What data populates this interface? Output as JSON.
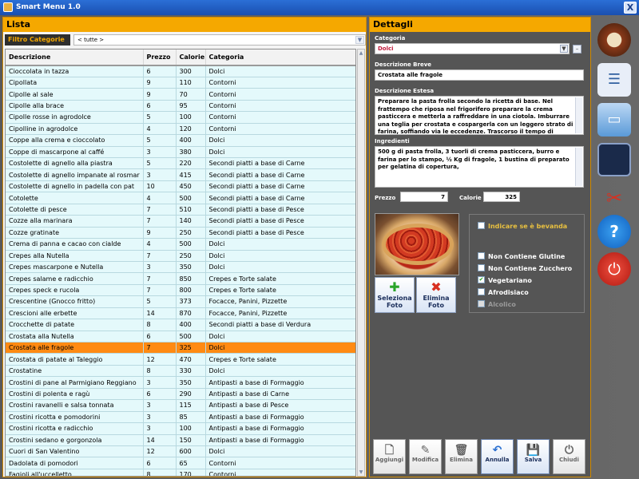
{
  "window": {
    "title": "Smart Menu 1.0",
    "close_glyph": "X"
  },
  "lista": {
    "title": "Lista",
    "filter_label": "Filtro Categorie",
    "filter_value": "< tutte >",
    "columns": [
      "Descrizione",
      "Prezzo",
      "Calorie",
      "Categoria"
    ],
    "rows": [
      [
        "Cioccolata in tazza",
        "6",
        "300",
        "Dolci"
      ],
      [
        "Cipollata",
        "9",
        "110",
        "Contorni"
      ],
      [
        "Cipolle al sale",
        "9",
        "70",
        "Contorni"
      ],
      [
        "Cipolle alla brace",
        "6",
        "95",
        "Contorni"
      ],
      [
        "Cipolle rosse in agrodolce",
        "5",
        "100",
        "Contorni"
      ],
      [
        "Cipolline in agrodolce",
        "4",
        "120",
        "Contorni"
      ],
      [
        "Coppe alla crema e cioccolato",
        "5",
        "400",
        "Dolci"
      ],
      [
        "Coppe di mascarpone al caffé",
        "3",
        "380",
        "Dolci"
      ],
      [
        "Costolette di agnello alla piastra",
        "5",
        "220",
        "Secondi piatti a base di Carne"
      ],
      [
        "Costolette di agnello impanate al rosmar",
        "3",
        "415",
        "Secondi piatti a base di Carne"
      ],
      [
        "Costolette di agnello in padella con pat",
        "10",
        "450",
        "Secondi piatti a base di Carne"
      ],
      [
        "Cotolette",
        "4",
        "500",
        "Secondi piatti a base di Carne"
      ],
      [
        "Cotolette di pesce",
        "7",
        "510",
        "Secondi piatti a base di Pesce"
      ],
      [
        "Cozze alla marinara",
        "7",
        "140",
        "Secondi piatti a base di Pesce"
      ],
      [
        "Cozze gratinate",
        "9",
        "250",
        "Secondi piatti a base di Pesce"
      ],
      [
        "Crema di panna e cacao con cialde",
        "4",
        "500",
        "Dolci"
      ],
      [
        "Crepes alla Nutella",
        "7",
        "250",
        "Dolci"
      ],
      [
        "Crepes mascarpone e Nutella",
        "3",
        "350",
        "Dolci"
      ],
      [
        "Crepes salame e radicchio",
        "7",
        "850",
        "Crepes e Torte salate"
      ],
      [
        "Crepes speck e rucola",
        "7",
        "800",
        "Crepes e Torte salate"
      ],
      [
        "Crescentine (Gnocco fritto)",
        "5",
        "373",
        "Focacce, Panini, Pizzette"
      ],
      [
        "Crescioni alle erbette",
        "14",
        "870",
        "Focacce, Panini, Pizzette"
      ],
      [
        "Crocchette di patate",
        "8",
        "400",
        "Secondi piatti a base di Verdura"
      ],
      [
        "Crostata alla Nutella",
        "6",
        "500",
        "Dolci"
      ],
      [
        "Crostata alle fragole",
        "7",
        "325",
        "Dolci"
      ],
      [
        "Crostata di patate al Taleggio",
        "12",
        "470",
        "Crepes e Torte salate"
      ],
      [
        "Crostatine",
        "8",
        "330",
        "Dolci"
      ],
      [
        "Crostini di pane al Parmigiano Reggiano",
        "3",
        "350",
        "Antipasti a base di Formaggio"
      ],
      [
        "Crostini di polenta e ragù",
        "6",
        "290",
        "Antipasti a base di Carne"
      ],
      [
        "Crostini ravanelli e salsa tonnata",
        "3",
        "115",
        "Antipasti a base di Pesce"
      ],
      [
        "Crostini ricotta e pomodorini",
        "3",
        "85",
        "Antipasti a base di Formaggio"
      ],
      [
        "Crostini ricotta e radicchio",
        "3",
        "100",
        "Antipasti a base di Formaggio"
      ],
      [
        "Crostini sedano e gorgonzola",
        "14",
        "150",
        "Antipasti a base di Formaggio"
      ],
      [
        "Cuori di San Valentino",
        "12",
        "600",
        "Dolci"
      ],
      [
        "Dadolata di pomodori",
        "6",
        "65",
        "Contorni"
      ],
      [
        "Fagioli all'uccelletto",
        "8",
        "170",
        "Contorni"
      ]
    ],
    "selected_index": 24
  },
  "dettagli": {
    "title": "Dettagli",
    "categoria_label": "Categoria",
    "categoria_value": "Dolci",
    "descrizione_breve_label": "Descrizione Breve",
    "descrizione_breve_value": "Crostata alle fragole",
    "descrizione_estesa_label": "Descrizione Estesa",
    "descrizione_estesa_value": "Preparare la pasta frolla secondo la ricetta di base. Nel frattempo che riposa nel frigorifero preparare la crema pasticcera e metterla a raffreddare in una ciotola.  Imburrare una teglia per crostata e cospargerla con un leggero strato di farina, soffiando via le eccedenze.  Trascorso il tempo di riposo della pasta, accendere il",
    "ingredienti_label": "Ingredienti",
    "ingredienti_value": "500 g di pasta frolla, 3 tuorli di crema pasticcera, burro e farina per lo stampo, ½ Kg di fragole, 1 bustina di preparato per gelatina di copertura,",
    "prezzo_label": "Prezzo",
    "prezzo_value": "7",
    "calorie_label": "Calorie",
    "calorie_value": "325",
    "seleziona_foto_label": "Seleziona Foto",
    "elimina_foto_label": "Elimina Foto",
    "bevanda_label": "Indicare se è bevanda",
    "flags": {
      "no_glutine": "Non Contiene Glutine",
      "no_zucchero": "Non Contiene Zucchero",
      "vegetariano": "Vegetariano",
      "afrodisiaco": "Afrodisiaco",
      "alcolico": "Alcolico"
    },
    "flags_checked": {
      "no_glutine": false,
      "no_zucchero": false,
      "vegetariano": true,
      "afrodisiaco": false,
      "alcolico": false
    },
    "actions": {
      "aggiungi": "Aggiungi",
      "modifica": "Modifica",
      "elimina": "Elimina",
      "annulla": "Annulla",
      "salva": "Salva",
      "chiudi": "Chiudi"
    }
  },
  "toolbar_icons": [
    "menu-plate-icon",
    "list-tree-icon",
    "folder-icon",
    "monitor-icon",
    "tools-icon",
    "help-icon",
    "power-icon"
  ],
  "colors": {
    "accent": "#f5a800",
    "selected_row": "#ff8a13",
    "row_bg": "#e4f9fb",
    "title_bar": "#1a4fb0"
  }
}
